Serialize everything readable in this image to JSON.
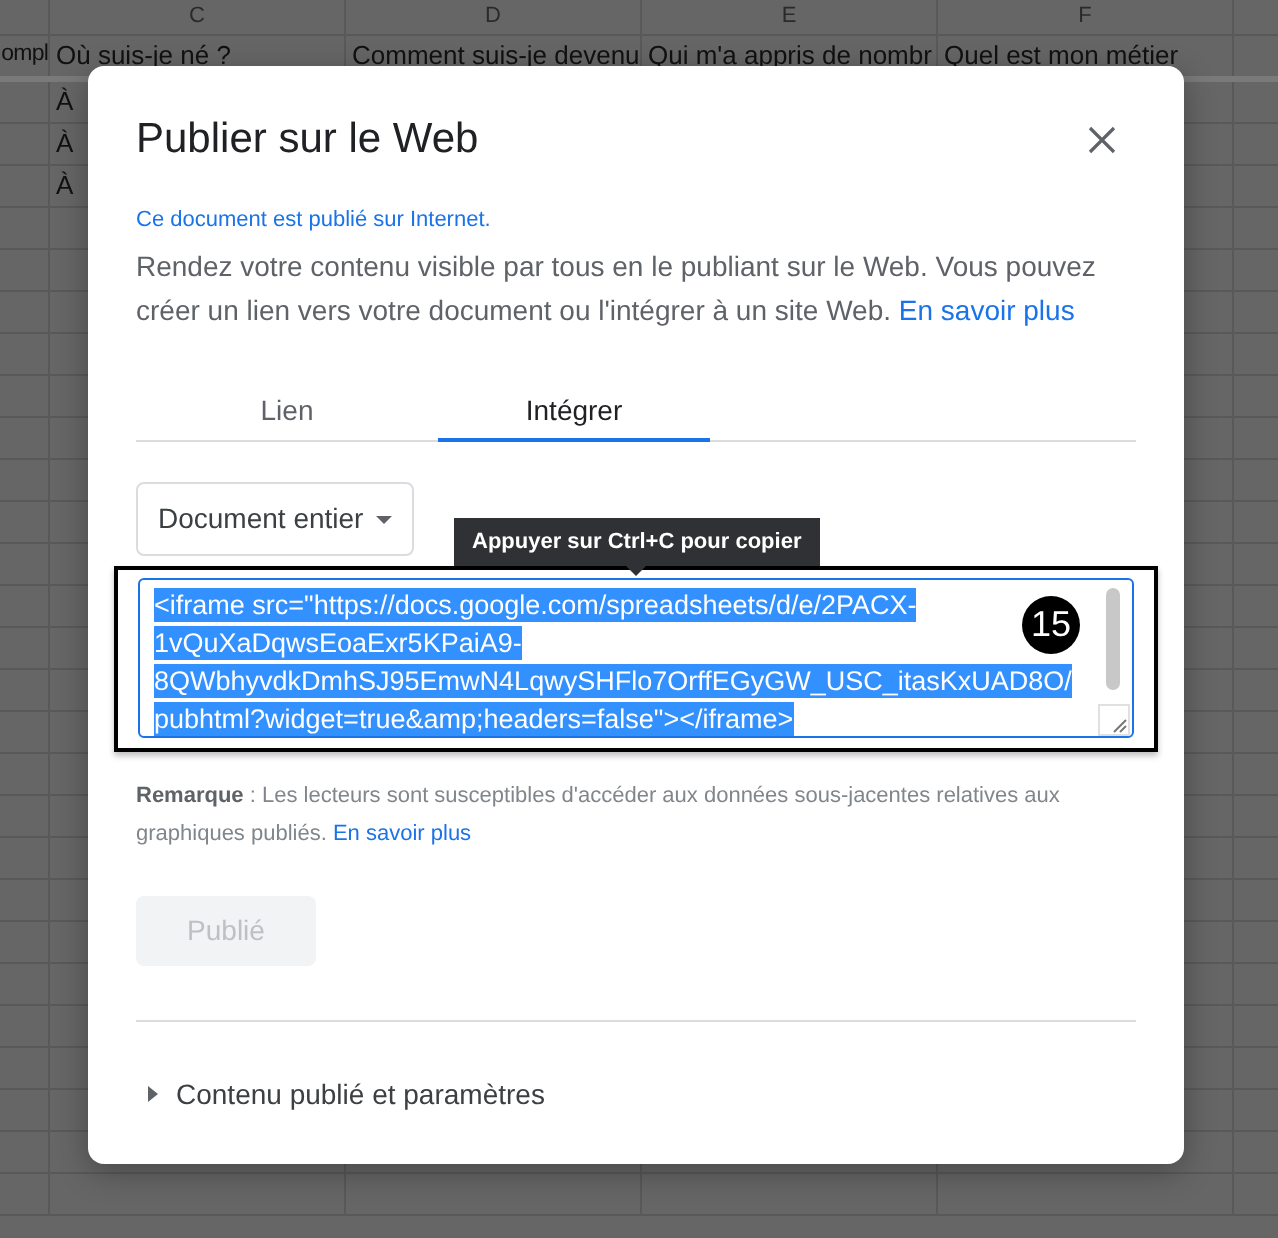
{
  "spreadsheet": {
    "columns": [
      {
        "cells": [
          "ompl"
        ]
      },
      {
        "header": "C",
        "cells": [
          "Où suis-je né ?",
          "À",
          "À",
          "À"
        ]
      },
      {
        "header": "D",
        "cells": [
          "Comment suis-je devenu"
        ]
      },
      {
        "header": "E",
        "cells": [
          "Qui m'a appris de nombr"
        ]
      },
      {
        "header": "F",
        "cells": [
          "Quel est mon métier"
        ]
      }
    ]
  },
  "dialog": {
    "title": "Publier sur le Web",
    "status_notice": "Ce document est publié sur Internet.",
    "description": {
      "text": "Rendez votre contenu visible par tous en le publiant sur le Web. Vous pouvez créer un lien vers votre document ou l'intégrer à un site Web.",
      "link": "En savoir plus"
    },
    "tabs": [
      {
        "label": "Lien",
        "selected": false
      },
      {
        "label": "Intégrer",
        "selected": true
      }
    ],
    "scope_dropdown": {
      "value": "Document entier"
    },
    "tooltip": "Appuyer sur Ctrl+C pour copier",
    "embed_code": {
      "value": "<iframe src=\"https://docs.google.com/spreadsheets/d/e/2PACX-1vQuXaDqwsEoaExr5KPaiA9-8QWbhyvdkDmhSJ95EmwN4LqwySHFlo7OrffEGyGW_USC_itasKxUAD8O/pubhtml?widget=true&amp;headers=false\"></iframe>",
      "selected": true
    },
    "badge": "15",
    "note": {
      "text": "**Remarque** : Les lecteurs sont susceptibles d'accéder aux données sous-jacentes relatives aux graphiques publiés.",
      "link": "En savoir plus"
    },
    "publish_button": {
      "label": "Publié",
      "disabled": true
    },
    "settings_section": {
      "label": "Contenu publié et paramètres",
      "expanded": false
    }
  }
}
